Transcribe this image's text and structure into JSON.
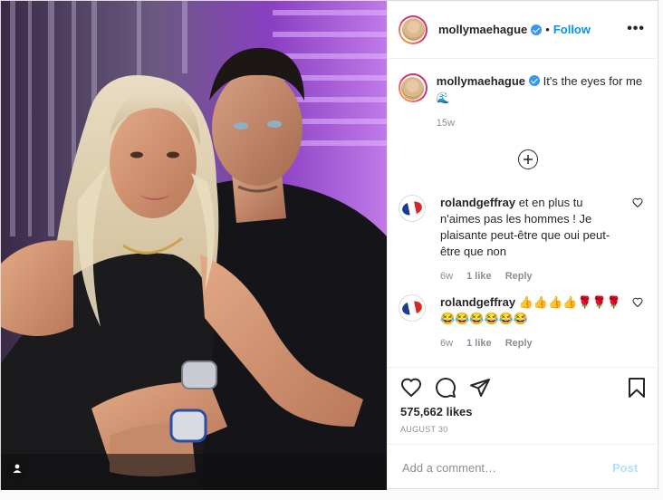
{
  "post": {
    "username": "mollymaehague",
    "follow_label": "Follow",
    "separator": "•",
    "more_label": "•••",
    "caption_text": "It's the eyes for me",
    "caption_emoji": "🌊",
    "caption_time": "15w"
  },
  "comments": [
    {
      "username": "roland­geffray",
      "text": "et en plus tu n'aimes pas les hommes ! Je plaisante peut-être que oui peut-être que non",
      "time": "6w",
      "likes": "1 like",
      "reply": "Reply"
    },
    {
      "username": "rolandgeffray",
      "text": "👍👍👍👍🌹🌹🌹😂😂😂😂😂😂",
      "time": "6w",
      "likes": "1 like",
      "reply": "Reply"
    }
  ],
  "stats": {
    "likes": "575,662 likes",
    "date": "AUGUST 30"
  },
  "composer": {
    "placeholder": "Add a comment…",
    "post_label": "Post"
  },
  "colors": {
    "accent": "#0095f6",
    "verified": "#3897f0",
    "muted": "#8e8e8e"
  },
  "icons": [
    "heart-icon",
    "comment-icon",
    "share-icon",
    "bookmark-icon",
    "plus-circle-icon",
    "verified-badge-icon",
    "user-tag-icon"
  ]
}
